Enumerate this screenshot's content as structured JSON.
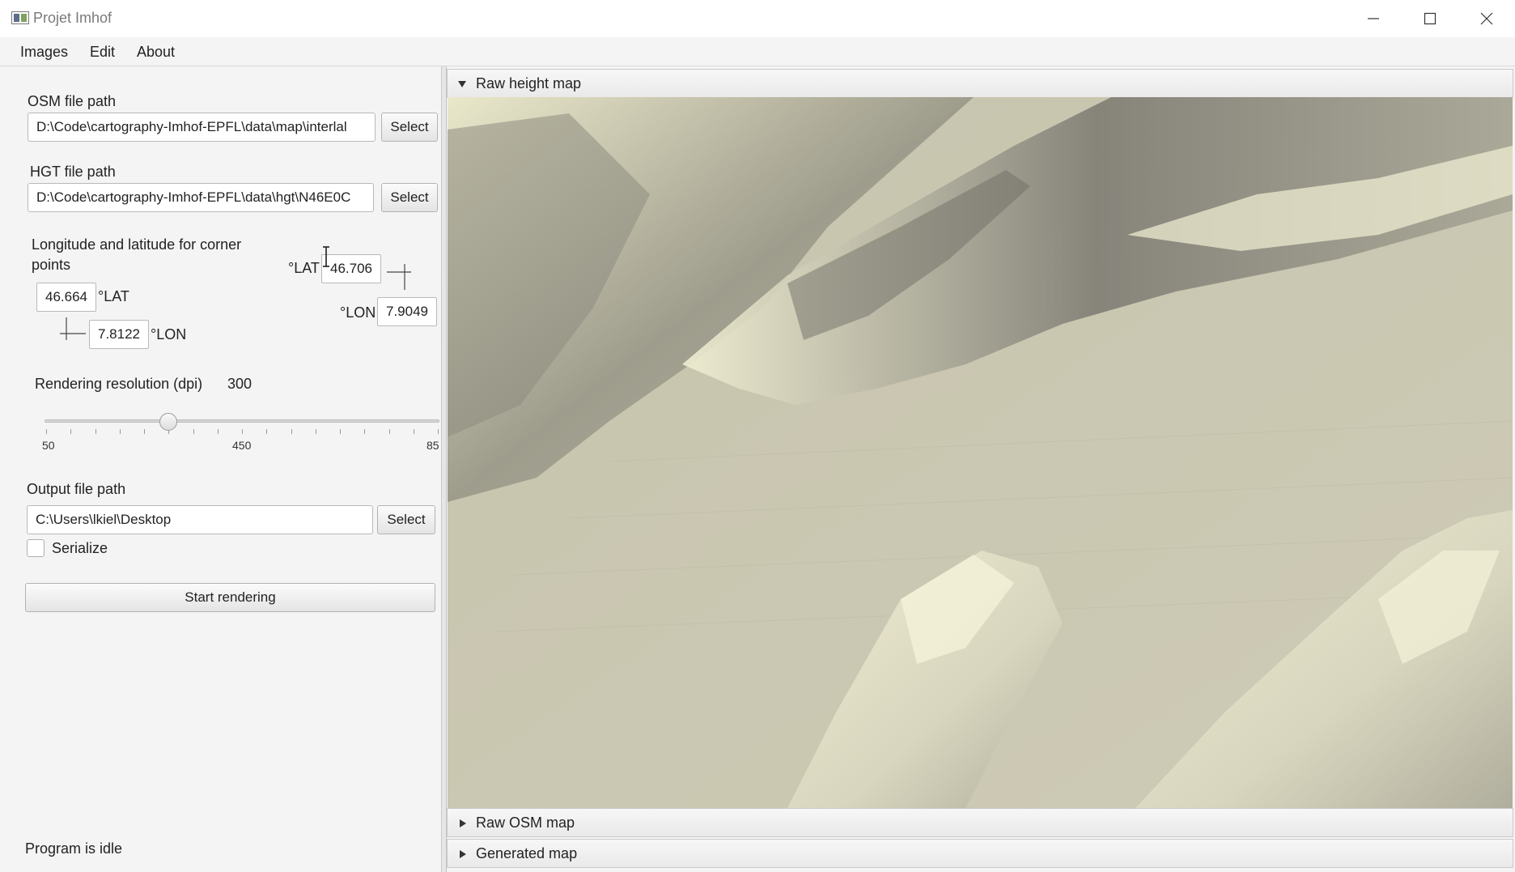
{
  "window": {
    "title": "Projet Imhof",
    "controls": [
      "minimize-icon",
      "maximize-icon",
      "close-icon"
    ]
  },
  "menubar": {
    "items": [
      "Images",
      "Edit",
      "About"
    ]
  },
  "left_panel": {
    "osm": {
      "label": "OSM file path",
      "value": "D:\\Code\\cartography-Imhof-EPFL\\data\\map\\interlal",
      "button": "Select"
    },
    "hgt": {
      "label": "HGT file path",
      "value": "D:\\Code\\cartography-Imhof-EPFL\\data\\hgt\\N46E0C",
      "button": "Select"
    },
    "corners": {
      "label_line1": "Longitude and latitude for corner",
      "label_line2": "points",
      "bottom_left": {
        "lat": "46.664",
        "lat_unit": "°LAT",
        "lon": "7.8122",
        "lon_unit": "°LON"
      },
      "top_right": {
        "lat": "46.706",
        "lat_unit": "°LAT",
        "lon": "7.9049",
        "lon_unit": "°LON"
      }
    },
    "resolution": {
      "label": "Rendering resolution (dpi)",
      "value": "300",
      "slider": {
        "min_label": "50",
        "mid_label": "450",
        "max_label": "85",
        "position": 0.3125
      }
    },
    "output": {
      "label": "Output file path",
      "value": "C:\\Users\\lkiel\\Desktop",
      "button": "Select"
    },
    "serialize": {
      "label": "Serialize",
      "checked": false
    },
    "start_button": "Start rendering",
    "status": "Program is idle"
  },
  "panes": [
    {
      "title": "Raw height map",
      "expanded": true
    },
    {
      "title": "Raw OSM map",
      "expanded": false
    },
    {
      "title": "Generated map",
      "expanded": false
    }
  ],
  "colors": {
    "window_bg": "#f4f4f4",
    "relief_light": "#eeeacc",
    "relief_mid": "#ccc9b4",
    "relief_dark": "#7d7c74"
  }
}
